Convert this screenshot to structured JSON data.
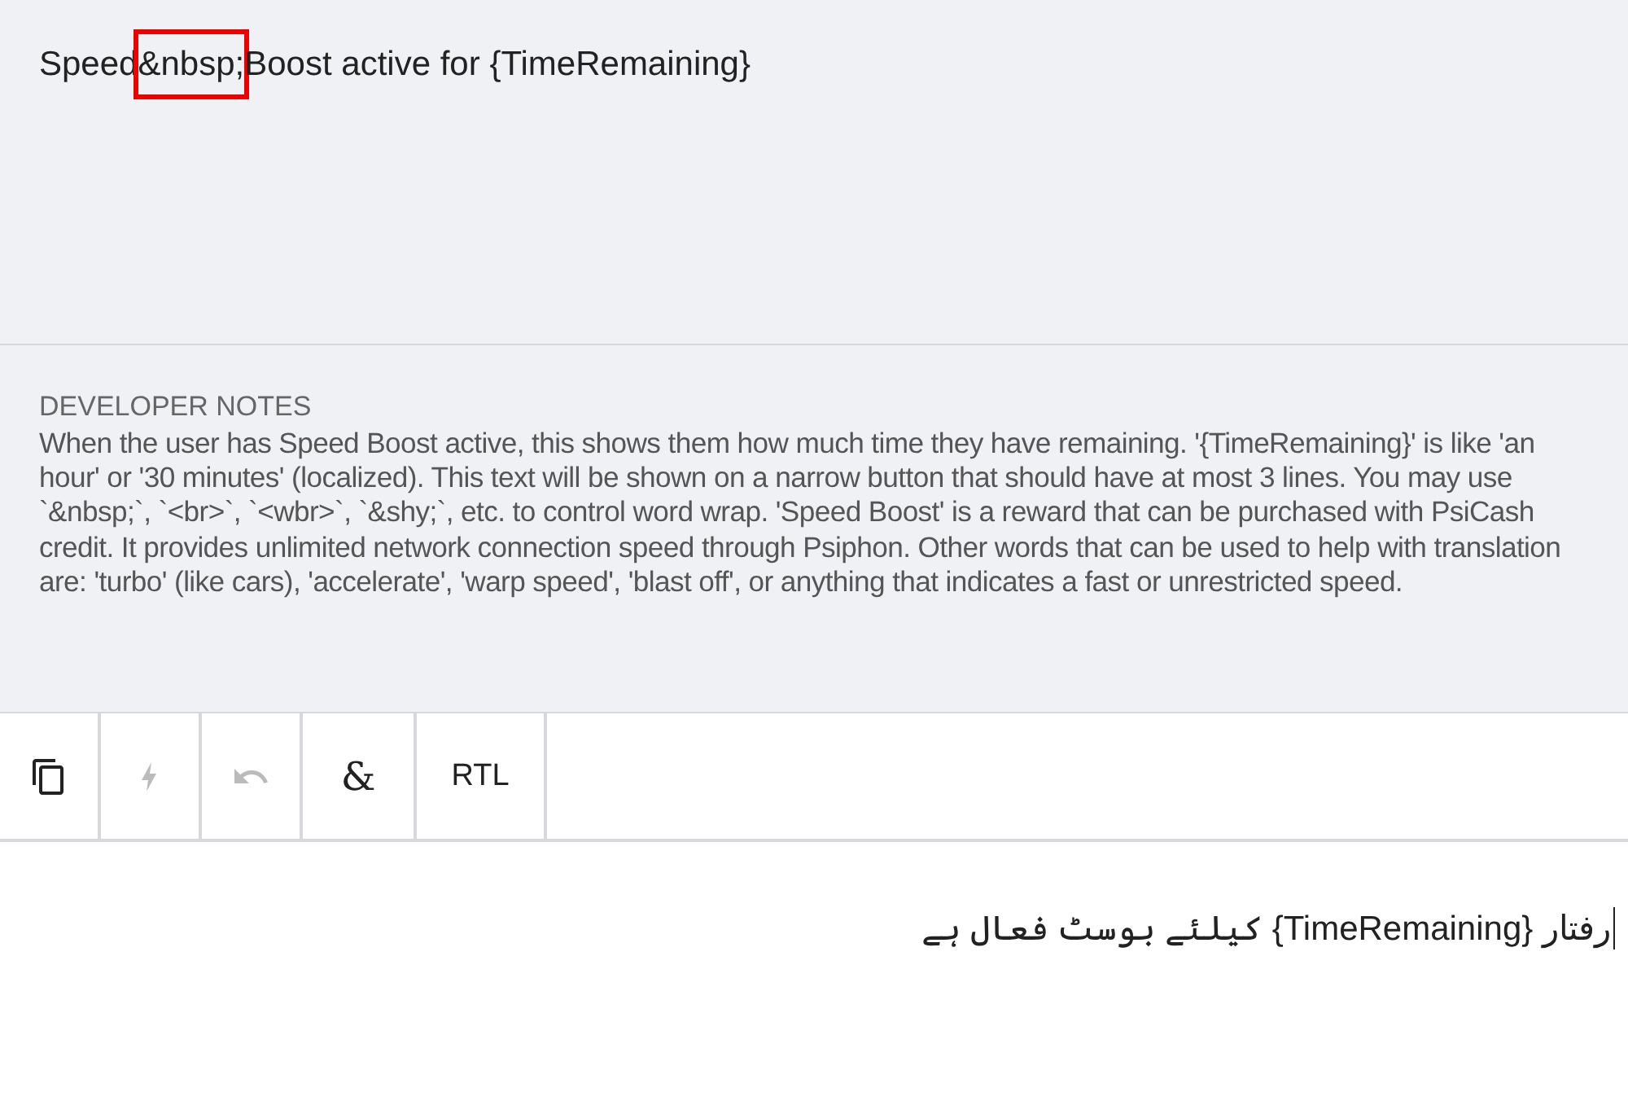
{
  "source": {
    "parts": [
      {
        "text": "Speed",
        "highlighted": false
      },
      {
        "text": "&nbsp;",
        "highlighted": true
      },
      {
        "text": "Boost active for {TimeRemaining}",
        "highlighted": false
      }
    ]
  },
  "developer_notes": {
    "heading": "DEVELOPER NOTES",
    "text": "When the user has Speed Boost active, this shows them how much time they have remaining. '{TimeRemaining}' is like 'an hour' or '30 minutes' (localized). This text will be shown on a narrow button that should have at most 3 lines. You may use `&nbsp;`, `<br>`, `<wbr>`, `&shy;`, etc. to control word wrap. 'Speed Boost' is a reward that can be purchased with PsiCash credit. It provides unlimited network connection speed through Psiphon. Other words that can be used to help with translation are: 'turbo' (like cars), 'accelerate', 'warp speed', 'blast off', or anything that indicates a fast or unrestricted speed."
  },
  "toolbar": [
    {
      "kind": "copy",
      "disabled": false
    },
    {
      "kind": "bolt",
      "disabled": true
    },
    {
      "kind": "undo",
      "disabled": true
    },
    {
      "kind": "char",
      "label": "&",
      "disabled": false
    },
    {
      "kind": "text",
      "label": "RTL",
      "disabled": false
    }
  ],
  "translation": {
    "value": "رفتار {TimeRemaining} کیلئے بوسٹ فعال ہے"
  }
}
